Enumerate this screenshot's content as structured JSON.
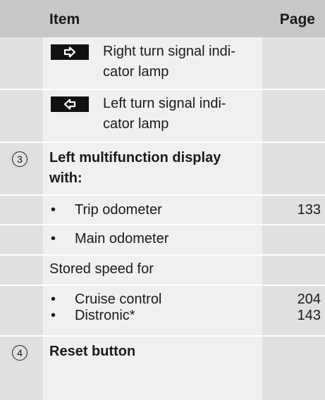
{
  "header": {
    "item_label": "Item",
    "page_label": "Page"
  },
  "rows": {
    "right_signal": {
      "line1": "Right turn signal indi-",
      "line2": "cator lamp",
      "icon": "right-arrow-icon"
    },
    "left_signal": {
      "line1": "Left turn signal indi-",
      "line2": "cator lamp",
      "icon": "left-arrow-icon"
    },
    "item3": {
      "number": "3",
      "title_line1": "Left multifunction display",
      "title_line2": "with:",
      "bullets": [
        {
          "bullet": "•",
          "text": "Trip odometer",
          "page": "133"
        },
        {
          "bullet": "•",
          "text": "Main odometer",
          "page": ""
        }
      ],
      "stored_label": "Stored speed for",
      "stored_bullets": [
        {
          "bullet": "•",
          "text": "Cruise control",
          "page": "204"
        },
        {
          "bullet": "•",
          "text": "Distronic*",
          "page": "143"
        }
      ]
    },
    "item4": {
      "number": "4",
      "title": "Reset button"
    }
  },
  "colors": {
    "header_bg": "#c8c8c8",
    "left_col": "#e0e0e0",
    "mid_col": "#f0f0f0",
    "lamp_bg": "#111111"
  }
}
